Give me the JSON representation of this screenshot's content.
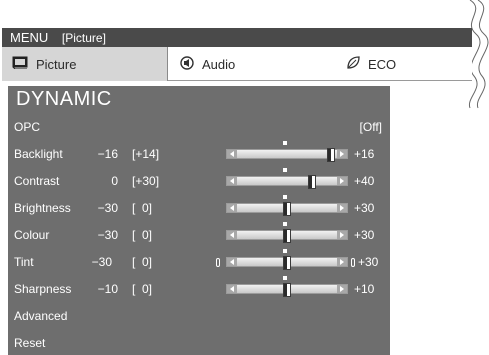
{
  "menu": {
    "title": "MENU",
    "section": "[Picture]"
  },
  "tabs": [
    {
      "label": "Picture",
      "icon": "picture-icon",
      "selected": true
    },
    {
      "label": "Audio",
      "icon": "speaker-icon",
      "selected": false
    },
    {
      "label": "ECO",
      "icon": "leaf-icon",
      "selected": false
    }
  ],
  "mode": "DYNAMIC",
  "rows": {
    "opc": {
      "label": "OPC",
      "value": "[Off]"
    },
    "backlight": {
      "label": "Backlight",
      "adjust": "[+14]",
      "min": "−16",
      "max": "+16",
      "level": 0.94
    },
    "contrast": {
      "label": "Contrast",
      "adjust": "[+30]",
      "min": "0",
      "max": "+40",
      "level": 0.75
    },
    "brightness": {
      "label": "Brightness",
      "adjust": "[  0]",
      "min": "−30",
      "max": "+30",
      "level": 0.5
    },
    "colour": {
      "label": "Colour",
      "adjust": "[  0]",
      "min": "−30",
      "max": "+30",
      "level": 0.5
    },
    "tint": {
      "label": "Tint",
      "adjust": "[  0]",
      "min": "−30",
      "max": "+30",
      "level": 0.5
    },
    "sharpness": {
      "label": "Sharpness",
      "adjust": "[  0]",
      "min": "−10",
      "max": "+10",
      "level": 0.5
    },
    "advanced": {
      "label": "Advanced"
    },
    "reset": {
      "label": "Reset"
    }
  },
  "colors": {
    "menu_bar": "#4a4a4a",
    "panel": "#6e6e6e",
    "selected_tab": "#d6d6d6"
  }
}
